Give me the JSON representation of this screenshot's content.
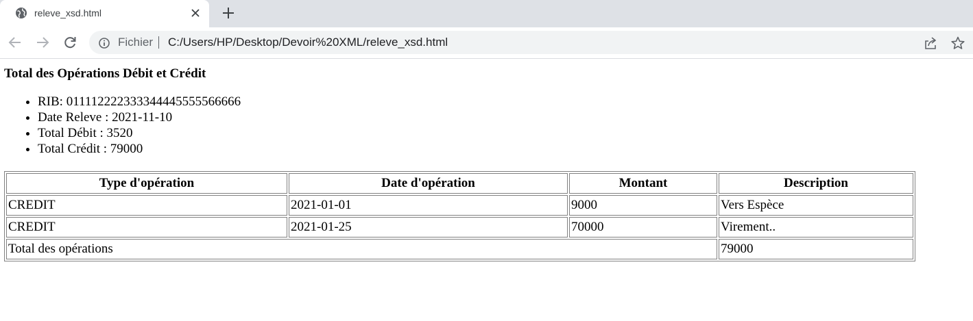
{
  "browser": {
    "tab": {
      "title": "releve_xsd.html",
      "favicon": "globe-icon",
      "close": "close-icon"
    },
    "new_tab": "plus-icon",
    "nav": {
      "back": "back-arrow-icon",
      "forward": "forward-arrow-icon",
      "reload": "reload-icon"
    },
    "omnibox": {
      "scheme_label": "Fichier",
      "url": "C:/Users/HP/Desktop/Devoir%20XML/releve_xsd.html",
      "info": "info-icon",
      "share": "share-icon",
      "bookmark": "star-icon"
    }
  },
  "page": {
    "heading": "Total des Opérations Débit et Crédit",
    "info": [
      "RIB: 011112222333344445555566666",
      "Date Releve : 2021-11-10",
      "Total Débit : 3520",
      "Total Crédit : 79000"
    ],
    "table": {
      "headers": [
        "Type d'opération",
        "Date d'opération",
        "Montant",
        "Description"
      ],
      "rows": [
        [
          "CREDIT",
          "2021-01-01",
          "9000",
          "Vers Espèce"
        ],
        [
          "CREDIT",
          "2021-01-25",
          "70000",
          "Virement.."
        ]
      ],
      "total_label": "Total des opérations",
      "total_value": "79000"
    }
  },
  "colors": {
    "tabstrip_bg": "#dee1e6",
    "omnibox_bg": "#f1f3f4",
    "icon_gray": "#5f6368"
  }
}
